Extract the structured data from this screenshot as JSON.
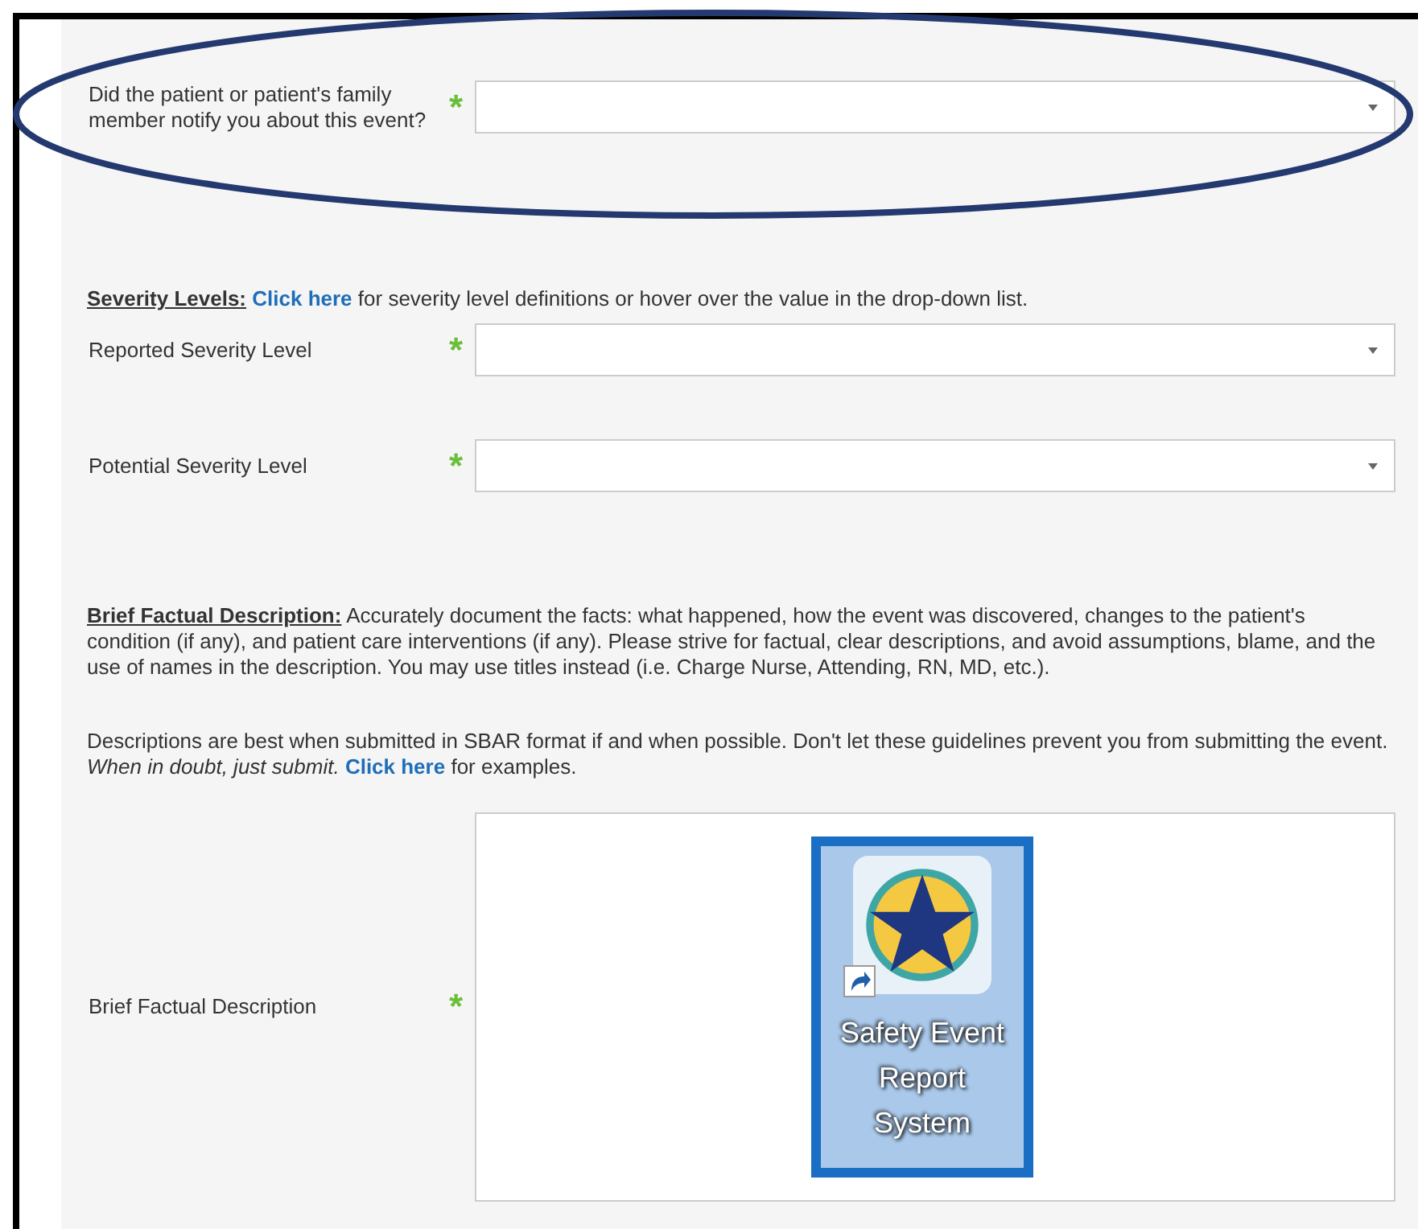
{
  "blocks": [
    {
      "kind": "select_field",
      "label": "Did the patient or patient's family member notify you about this event?",
      "required": "*",
      "circled": true
    },
    {
      "kind": "paragraph",
      "segments": [
        {
          "kind": "heading",
          "text": "Severity Levels:"
        },
        {
          "kind": "link",
          "text": "Click here"
        },
        {
          "kind": "plain",
          "text": "for severity level definitions or hover over the value in the drop-down list."
        }
      ]
    },
    {
      "kind": "select_field",
      "label": "Reported Severity Level",
      "required": "*",
      "circled": false
    },
    {
      "kind": "select_field",
      "label": "Potential Severity Level",
      "required": "*",
      "circled": false
    },
    {
      "kind": "paragraph",
      "segments": [
        {
          "kind": "heading",
          "text": "Brief Factual Description:"
        },
        {
          "kind": "plain",
          "text": "Accurately document the facts: what happened, how the event was discovered, changes to the patient's condition (if any), and patient care interventions (if any). Please strive for factual, clear descriptions, and avoid assumptions, blame, and the use of names in the description. You may use titles instead (i.e. Charge Nurse, Attending, RN, MD, etc.)."
        }
      ]
    },
    {
      "kind": "paragraph",
      "segments": [
        {
          "kind": "plain",
          "text": "Descriptions are best when submitted in SBAR format if and when possible. Don't let these guidelines prevent you from submitting the event."
        },
        {
          "kind": "italic",
          "text": "When in doubt, just submit."
        },
        {
          "kind": "link",
          "text": "Click here"
        },
        {
          "kind": "plain",
          "text": "for examples."
        }
      ]
    },
    {
      "kind": "textarea_field",
      "label": "Brief Factual Description",
      "required": "*",
      "circled": false,
      "content": {
        "kind": "shortcut",
        "label": "Safety Event Report System"
      }
    }
  ]
}
